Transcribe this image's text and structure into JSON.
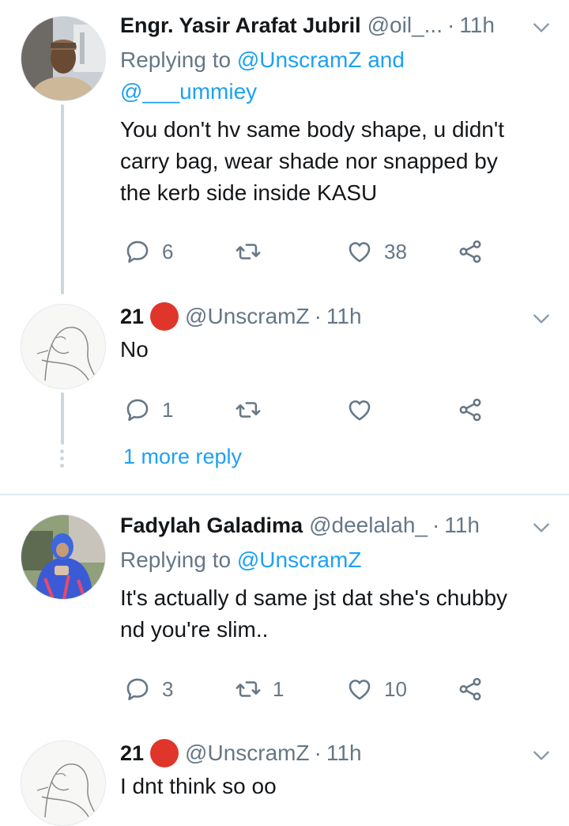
{
  "tweets": [
    {
      "name": "Engr. Yasir Arafat Jubril",
      "handle": "@oil_...",
      "time": "11h",
      "replying_prefix": "Replying to ",
      "replying_to_1": "@UnscramZ",
      "replying_join": " and",
      "replying_to_2": "@___ummiey",
      "text_lines": [
        "You don't hv same body shape, u didn't",
        "carry bag, wear shade nor snapped by",
        "the kerb side inside KASU"
      ],
      "replies": "6",
      "retweets": "",
      "likes": "38"
    },
    {
      "name": "21",
      "handle": "@UnscramZ",
      "time": "11h",
      "text_lines": [
        "No"
      ],
      "replies": "1",
      "retweets": "",
      "likes": "",
      "more_replies": "1 more reply"
    },
    {
      "name": "Fadylah Galadima",
      "handle": "@deelalah_",
      "time": "11h",
      "replying_prefix": "Replying to ",
      "replying_to_1": "@UnscramZ",
      "text_lines": [
        "It's actually d same jst dat she's chubby",
        "nd you're slim.."
      ],
      "replies": "3",
      "retweets": "1",
      "likes": "10"
    },
    {
      "name": "21",
      "handle": "@UnscramZ",
      "time": "11h",
      "text_lines": [
        "I dnt think so oo"
      ]
    }
  ],
  "dot": "·",
  "colors": {
    "accent": "#1da1f2",
    "muted": "#657786",
    "status_dot": "#e0352b"
  },
  "icons": [
    "reply-icon",
    "retweet-icon",
    "like-icon",
    "share-icon",
    "chevron-down-icon"
  ]
}
